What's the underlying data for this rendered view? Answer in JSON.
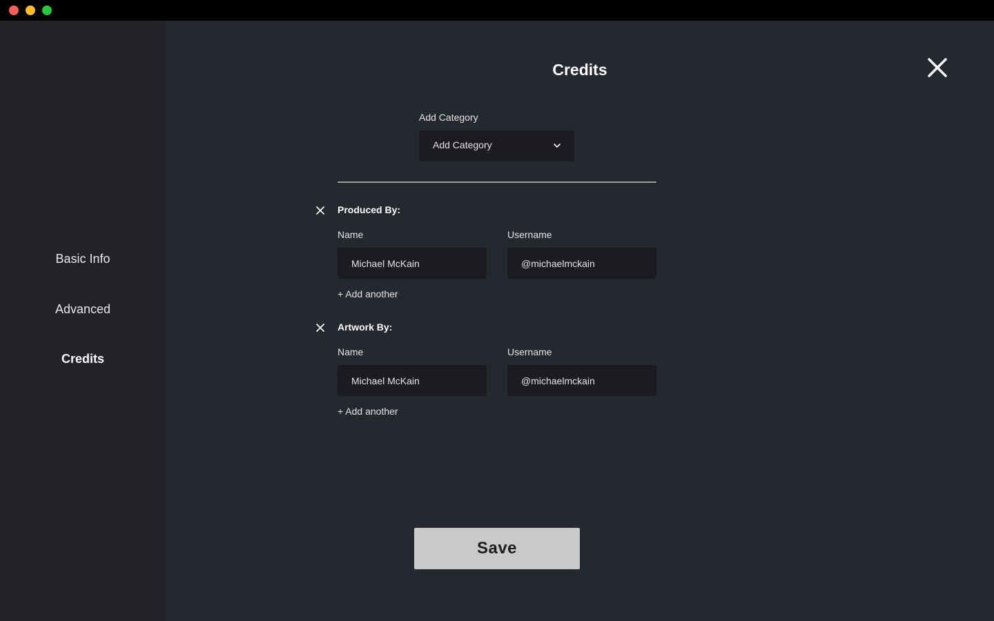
{
  "sidebar": {
    "items": [
      {
        "label": "Basic Info"
      },
      {
        "label": "Advanced"
      },
      {
        "label": "Credits"
      }
    ]
  },
  "header": {
    "title": "Credits"
  },
  "category": {
    "label": "Add Category",
    "selected": "Add Category"
  },
  "sections": [
    {
      "title": "Produced By:",
      "name_label": "Name",
      "username_label": "Username",
      "name_value": "Michael McKain",
      "username_value": "@michaelmckain",
      "add_another": "+ Add another"
    },
    {
      "title": "Artwork By:",
      "name_label": "Name",
      "username_label": "Username",
      "name_value": "Michael McKain",
      "username_value": "@michaelmckain",
      "add_another": "+ Add another"
    }
  ],
  "footer": {
    "save_label": "Save"
  },
  "icons": {
    "close": "close-icon",
    "remove": "remove-icon",
    "chevron": "chevron-down-icon"
  },
  "colors": {
    "sidebar_bg": "#222329",
    "main_bg": "#262830",
    "field_bg": "#1b1c21",
    "save_bg": "#c9c9c9"
  }
}
